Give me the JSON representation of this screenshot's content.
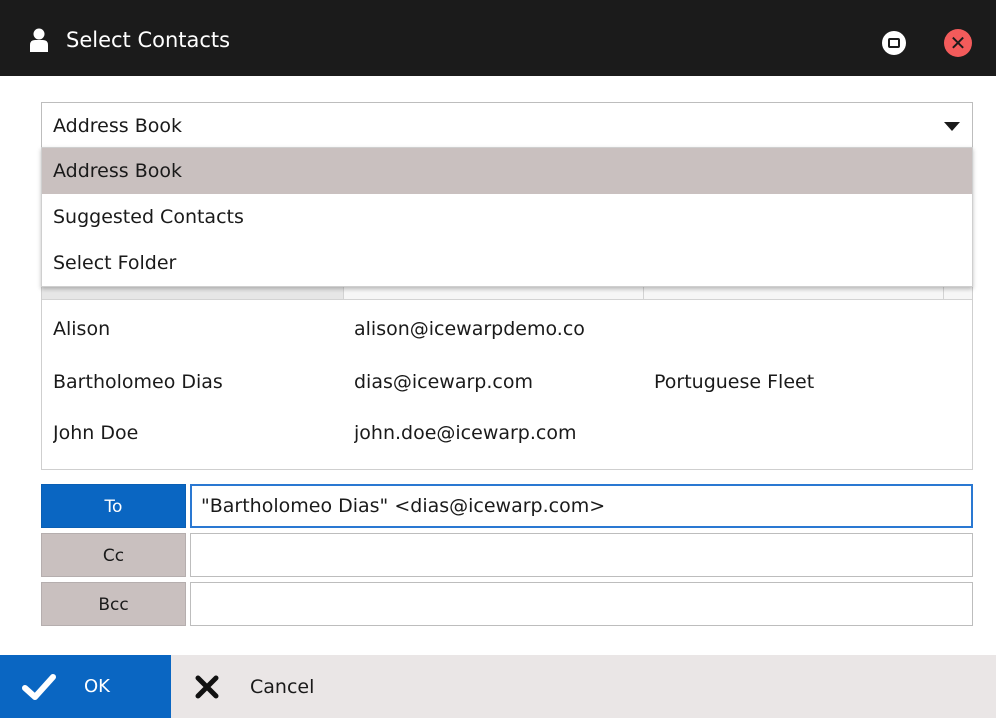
{
  "window": {
    "title": "Select Contacts",
    "icon": "user-icon",
    "controls": [
      "restore-icon",
      "close-icon"
    ],
    "close_glyph": "✕"
  },
  "source_select": {
    "value": "Address Book",
    "options": [
      {
        "label": "Address Book",
        "selected": true
      },
      {
        "label": "Suggested Contacts",
        "selected": false
      },
      {
        "label": "Select Folder",
        "selected": false
      }
    ]
  },
  "contacts": {
    "rows": [
      {
        "name": "Alison",
        "email": "alison@icewarpdemo.co",
        "company": ""
      },
      {
        "name": "Bartholomeo Dias",
        "email": "dias@icewarp.com",
        "company": "Portuguese Fleet"
      },
      {
        "name": "John Doe",
        "email": "john.doe@icewarp.com",
        "company": ""
      }
    ]
  },
  "recipients": {
    "to": {
      "label": "To",
      "value": "\"Bartholomeo Dias\" <dias@icewarp.com>"
    },
    "cc": {
      "label": "Cc",
      "value": ""
    },
    "bcc": {
      "label": "Bcc",
      "value": ""
    }
  },
  "footer": {
    "ok_label": "OK",
    "cancel_label": "Cancel"
  },
  "colors": {
    "titlebar": "#1b1b1b",
    "accent": "#0a66c2",
    "selected_option": "#c9c0bf",
    "close": "#f35b5b",
    "footer": "#eae6e6"
  }
}
